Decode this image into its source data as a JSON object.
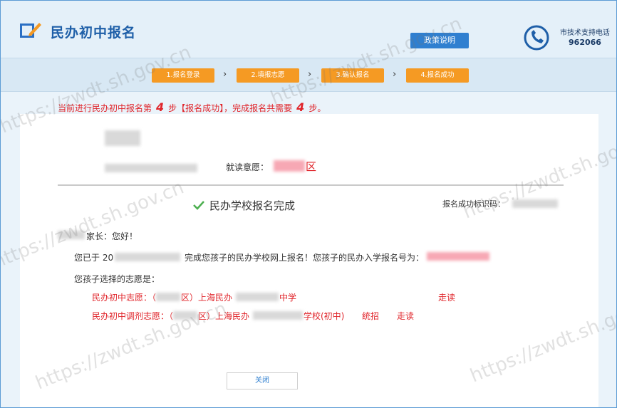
{
  "header": {
    "title": "民办初中报名",
    "policy_button": "政策说明",
    "support_label": "市技术支持电话",
    "support_phone": "962066"
  },
  "steps": [
    {
      "label": "1.报名登录"
    },
    {
      "label": "2.填报志愿"
    },
    {
      "label": "3.确认报名"
    },
    {
      "label": "4.报名成功"
    }
  ],
  "step_arrow": "›",
  "notice": {
    "before": "当前进行民办初中报名第",
    "step_num": "4",
    "middle": "步【报名成功】，完成报名共需要",
    "total_num": "4",
    "after": "步。"
  },
  "student": {
    "volunteer_label": "就读意愿：",
    "district_suffix": "区"
  },
  "result": {
    "title": "民办学校报名完成",
    "code_label": "报名成功标识码："
  },
  "message": {
    "greeting": "家长：您好！",
    "line1_prefix": "您已于 20",
    "line1_suffix": "完成您孩子的民办学校网上报名！您孩子的民办入学报名号为：",
    "line2": "您孩子选择的志愿是：",
    "choice1_label": "民办初中志愿：（",
    "choice1_mid": "区）上海民办",
    "choice1_end": "中学",
    "choice1_status": "走读",
    "choice2_label": "民办初中调剂志愿：（",
    "choice2_mid": "区）上海民办",
    "choice2_end": "学校(初中)",
    "choice2_type": "统招",
    "choice2_status": "走读"
  },
  "close_button": "关闭",
  "watermark": "https://zwdt.sh.gov.cn",
  "colors": {
    "brand_blue": "#1e5fa8",
    "step_orange": "#f59a23",
    "alert_red": "#e0242a",
    "success_green": "#4caf50"
  }
}
